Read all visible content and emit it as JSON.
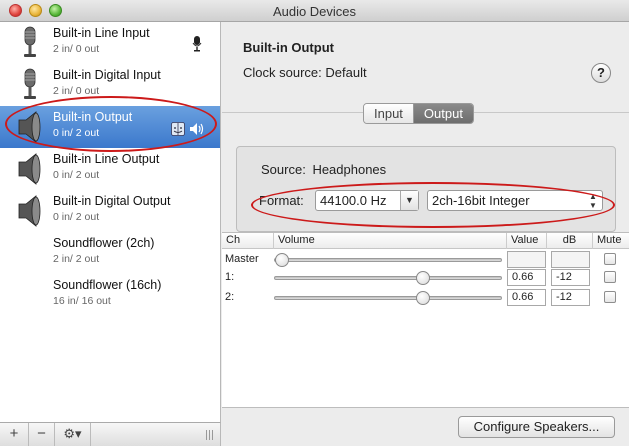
{
  "window": {
    "title": "Audio Devices"
  },
  "devices": [
    {
      "name": "Built-in Line Input",
      "channels": "2 in/ 0 out",
      "icon": "microphone-icon",
      "selected": false
    },
    {
      "name": "Built-in Digital Input",
      "channels": "2 in/ 0 out",
      "icon": "microphone-icon",
      "selected": false
    },
    {
      "name": "Built-in Output",
      "channels": "0 in/ 2 out",
      "icon": "speaker-icon",
      "selected": true
    },
    {
      "name": "Built-in Line Output",
      "channels": "0 in/ 2 out",
      "icon": "speaker-icon",
      "selected": false
    },
    {
      "name": "Built-in Digital Output",
      "channels": "0 in/ 2 out",
      "icon": "speaker-icon",
      "selected": false
    },
    {
      "name": "Soundflower (2ch)",
      "channels": "2 in/ 2 out",
      "icon": "",
      "selected": false
    },
    {
      "name": "Soundflower (16ch)",
      "channels": "16 in/ 16 out",
      "icon": "",
      "selected": false
    }
  ],
  "bottombar": {
    "add_label": "+",
    "remove_label": "−",
    "gear_label": "⚙▾"
  },
  "detail": {
    "device_name": "Built-in Output",
    "clock_source_label": "Clock source:",
    "clock_source_value": "Default",
    "help_label": "?",
    "tabs": [
      {
        "label": "Input",
        "active": false
      },
      {
        "label": "Output",
        "active": true
      }
    ],
    "source_label": "Source:",
    "source_value": "Headphones",
    "format_label": "Format:",
    "sample_rate": "44100.0 Hz",
    "bit_format": "2ch-16bit Integer"
  },
  "table": {
    "columns": [
      "Ch",
      "Volume",
      "Value",
      "dB",
      "Mute"
    ],
    "rows": [
      {
        "label": "Master",
        "value": "",
        "db": "",
        "level": 0
      },
      {
        "label": "1:",
        "value": "0.66",
        "db": "-12",
        "level": 0.66
      },
      {
        "label": "2:",
        "value": "0.66",
        "db": "-12",
        "level": 0.66
      }
    ]
  },
  "configure_button": "Configure Speakers...",
  "colors": {
    "selection": "#3b78cc",
    "annotation": "#cc1a1a"
  }
}
